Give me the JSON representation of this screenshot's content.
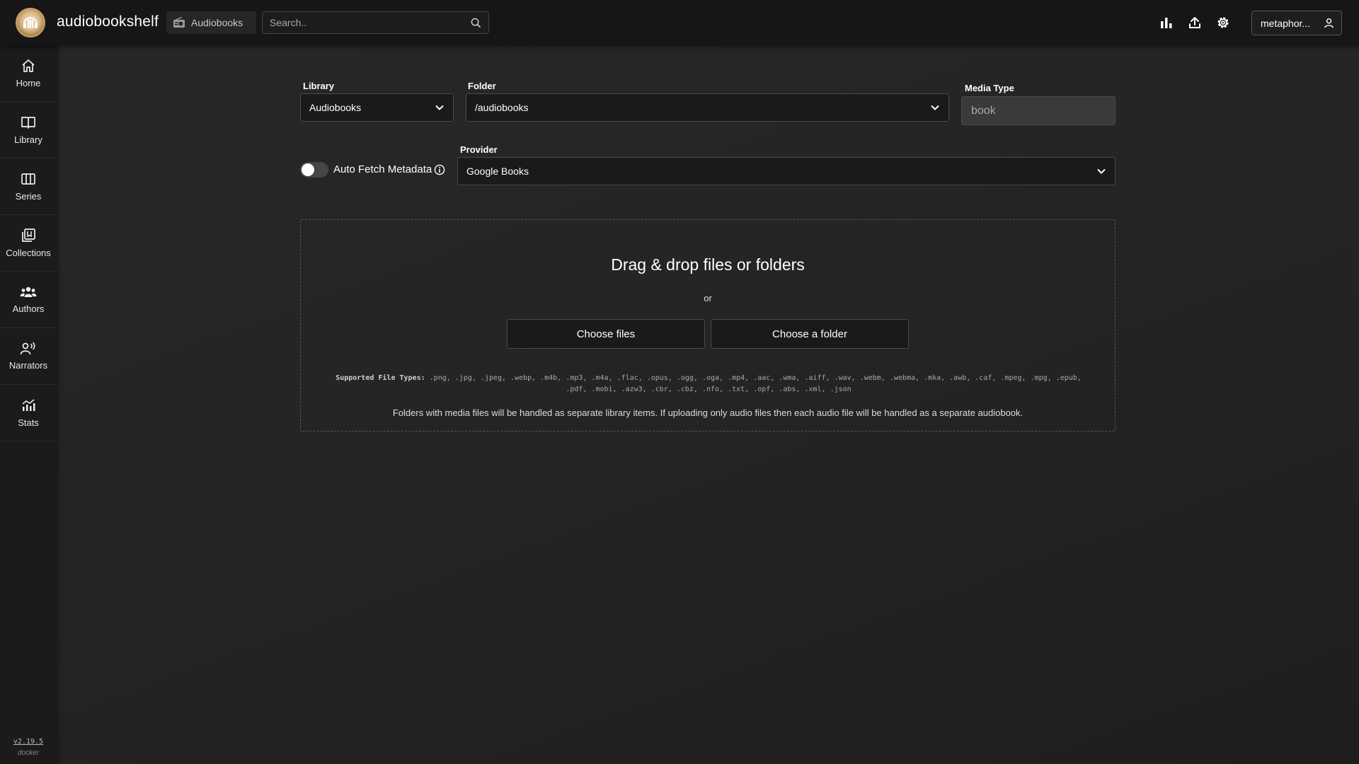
{
  "app": {
    "title": "audiobookshelf"
  },
  "header": {
    "library_pill": "Audiobooks",
    "search_placeholder": "Search..",
    "user_label": "metaphor..."
  },
  "sidebar": {
    "items": [
      {
        "label": "Home",
        "icon": "home-icon"
      },
      {
        "label": "Library",
        "icon": "book-open-icon"
      },
      {
        "label": "Series",
        "icon": "columns-icon"
      },
      {
        "label": "Collections",
        "icon": "collections-icon"
      },
      {
        "label": "Authors",
        "icon": "authors-icon"
      },
      {
        "label": "Narrators",
        "icon": "narrator-icon"
      },
      {
        "label": "Stats",
        "icon": "stats-icon"
      }
    ],
    "version": "v2.19.5",
    "build": "docker"
  },
  "form": {
    "library_label": "Library",
    "library_value": "Audiobooks",
    "folder_label": "Folder",
    "folder_value": "/audiobooks",
    "media_type_label": "Media Type",
    "media_type_value": "book",
    "auto_fetch_label": "Auto Fetch Metadata",
    "auto_fetch_enabled": false,
    "provider_label": "Provider",
    "provider_value": "Google Books"
  },
  "dropzone": {
    "title": "Drag & drop files or folders",
    "or": "or",
    "choose_files": "Choose files",
    "choose_folder": "Choose a folder",
    "supported_label": "Supported File Types:",
    "supported_types": ".png, .jpg, .jpeg, .webp, .m4b, .mp3, .m4a, .flac, .opus, .ogg, .oga, .mp4, .aac, .wma, .aiff, .wav, .webm, .webma, .mka, .awb, .caf, .mpeg, .mpg, .epub, .pdf, .mobi, .azw3, .cbr, .cbz, .nfo, .txt, .opf, .abs, .xml, .json",
    "note": "Folders with media files will be handled as separate library items. If uploading only audio files then each audio file will be handled as a separate audiobook."
  },
  "colors": {
    "topbar": "#161616",
    "sidebar": "#1b1b1b",
    "main": "#242424",
    "input_bg": "#1a1a1a"
  }
}
